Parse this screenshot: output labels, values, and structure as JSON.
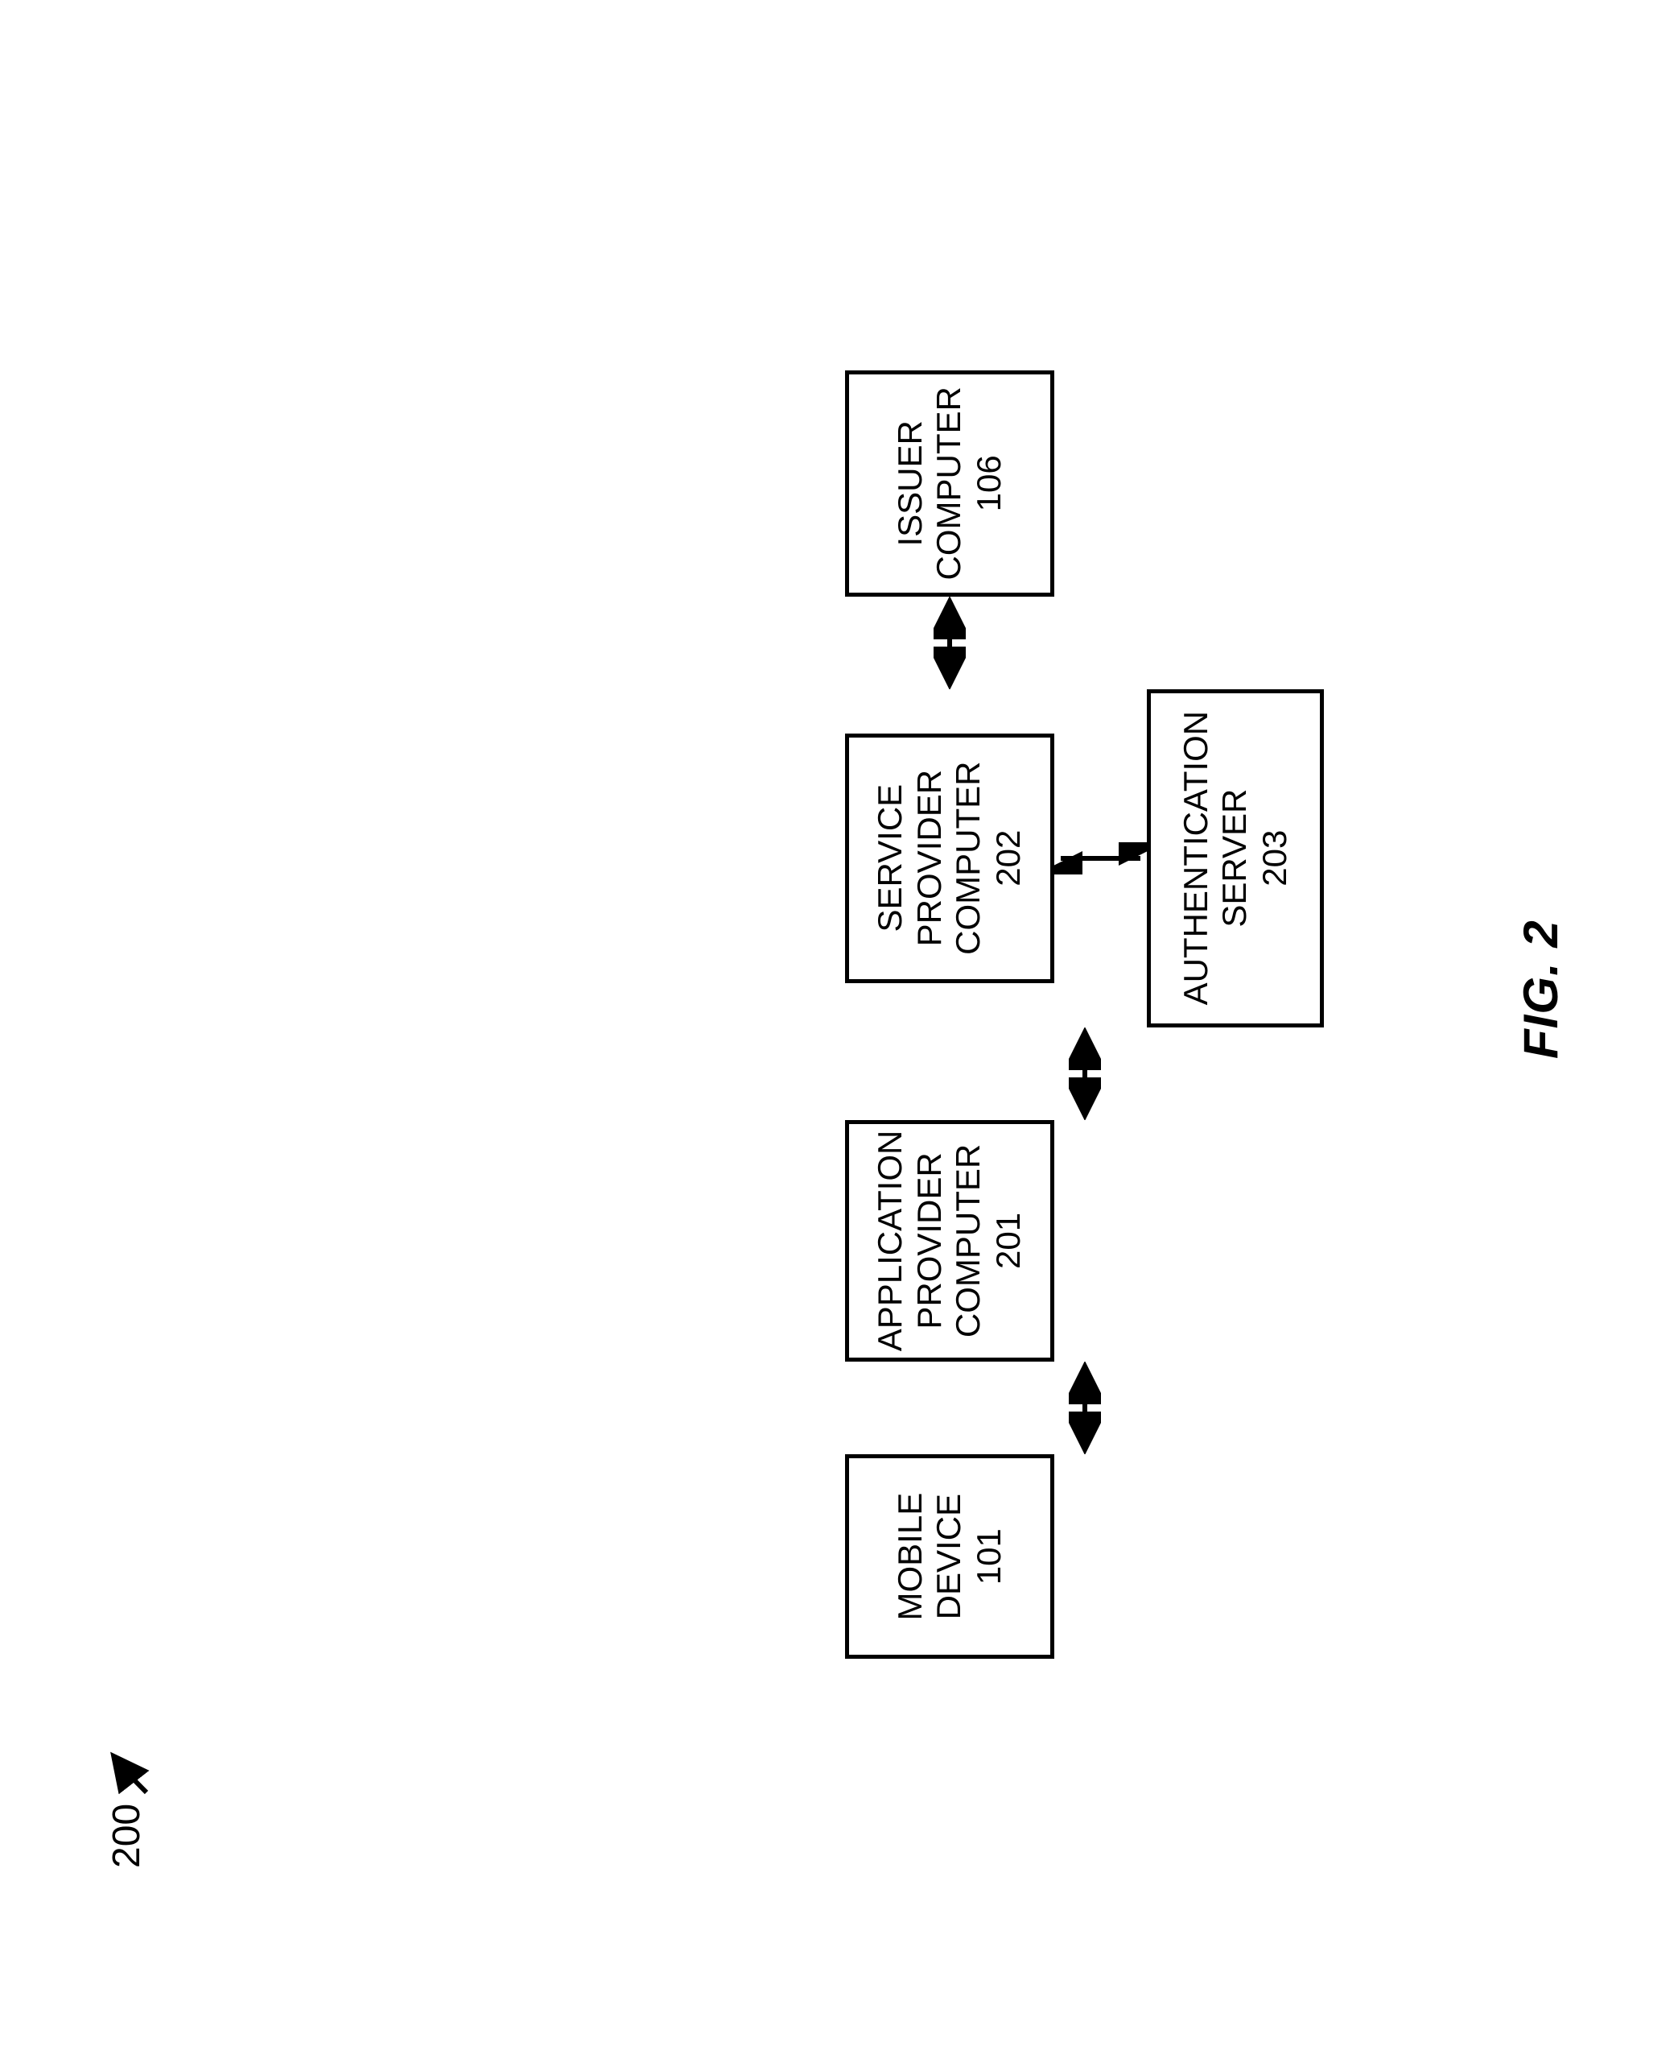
{
  "figure": {
    "label": "FIG. 2",
    "reference": "200"
  },
  "nodes": {
    "mobile": {
      "lines": [
        "MOBILE",
        "DEVICE"
      ],
      "id": "101"
    },
    "app": {
      "lines": [
        "APPLICATION",
        "PROVIDER",
        "COMPUTER"
      ],
      "id": "201"
    },
    "service": {
      "lines": [
        "SERVICE",
        "PROVIDER",
        "COMPUTER"
      ],
      "id": "202"
    },
    "issuer": {
      "lines": [
        "ISSUER",
        "COMPUTER"
      ],
      "id": "106"
    },
    "auth": {
      "lines": [
        "AUTHENTICATION",
        "SERVER"
      ],
      "id": "203"
    }
  },
  "edges": [
    {
      "from": "mobile",
      "to": "app",
      "dir": "both",
      "orientation": "h"
    },
    {
      "from": "app",
      "to": "service",
      "dir": "both",
      "orientation": "h"
    },
    {
      "from": "service",
      "to": "issuer",
      "dir": "both",
      "orientation": "h"
    },
    {
      "from": "service",
      "to": "auth",
      "dir": "both",
      "orientation": "v"
    }
  ]
}
